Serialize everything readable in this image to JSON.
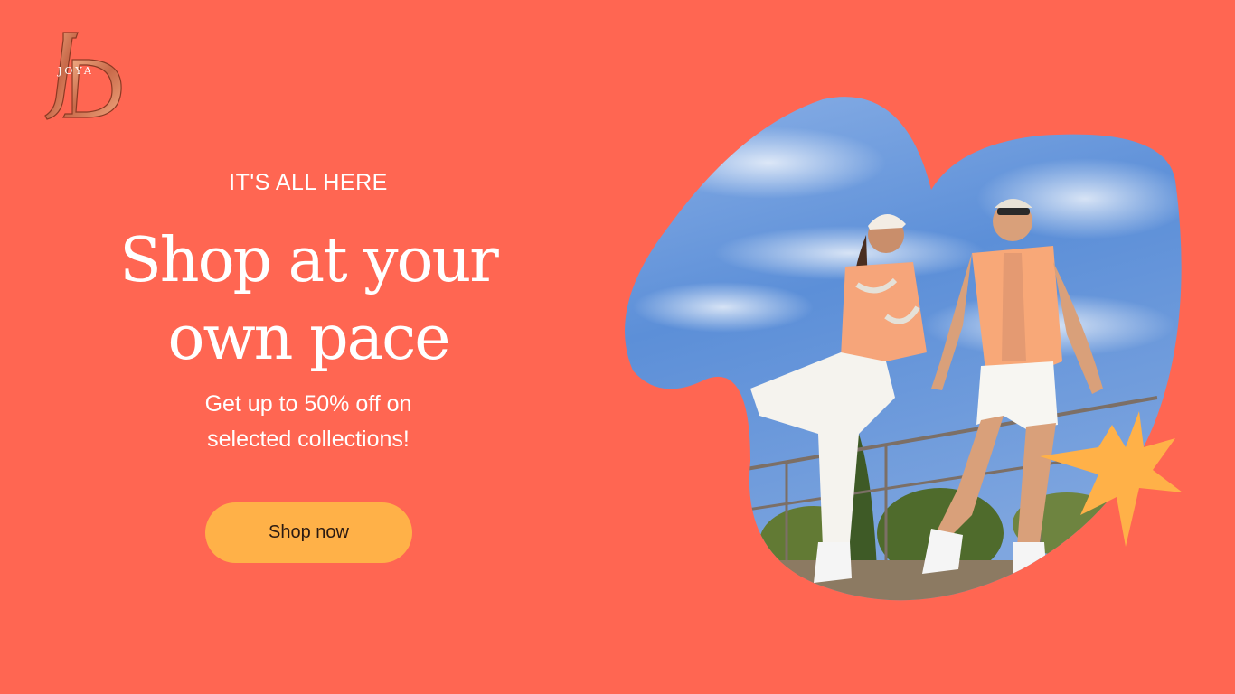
{
  "brand": {
    "logo_icon": "jd-monogram-logo",
    "logo_text": "JOYA",
    "colors": {
      "background": "#FF6652",
      "accent": "#FFB148",
      "text": "#FFFFFF"
    }
  },
  "hero": {
    "eyebrow": "IT'S ALL HERE",
    "headline_line1": "Shop at your",
    "headline_line2": "own pace",
    "subtext_line1": "Get up to 50% off on",
    "subtext_line2": "selected collections!",
    "cta_label": "Shop now"
  },
  "media": {
    "photo_icon": "models-on-terrace-photo",
    "decoration_icon": "starburst-icon"
  }
}
